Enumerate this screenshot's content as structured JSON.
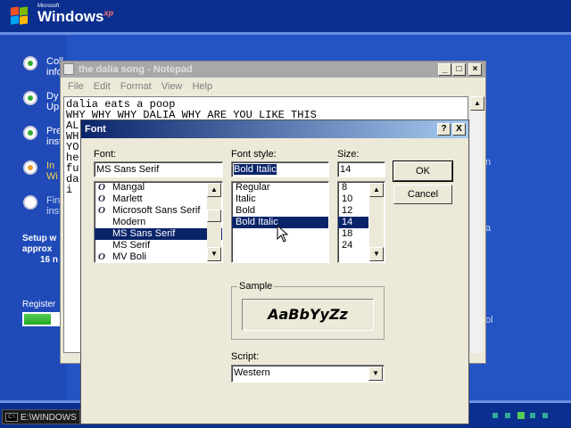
{
  "setup": {
    "logo_small": "Microsoft",
    "logo_main": "Windows",
    "logo_sup": "xp",
    "steps": [
      {
        "line1": "Coll",
        "line2": "info",
        "state": "done"
      },
      {
        "line1": "Dy",
        "line2": "Up",
        "state": "done"
      },
      {
        "line1": "Pre",
        "line2": "inst",
        "state": "done"
      },
      {
        "line1": "In",
        "line2": "Wi",
        "state": "current"
      },
      {
        "line1": "Fin",
        "line2": "inst",
        "state": "future"
      }
    ],
    "time_line1": "Setup w",
    "time_line2": "approx",
    "time_line3": "16 n",
    "register_label": "Register",
    "right_fragments": [
      "n",
      "a",
      "ol"
    ]
  },
  "notepad": {
    "title": "the dalia song - Notepad",
    "menu": [
      "File",
      "Edit",
      "Format",
      "View",
      "Help"
    ],
    "lines": [
      "dalia eats a poop",
      "WHY WHY WHY DALIA WHY ARE YOU LIKE THIS",
      "AL",
      "WH",
      "YO",
      "he",
      "fu",
      "da",
      "i"
    ]
  },
  "font_dialog": {
    "title": "Font",
    "help_btn": "?",
    "close_btn": "X",
    "font_label": "Font:",
    "font_value": "MS Sans Serif",
    "fonts": [
      {
        "name": "Mangal",
        "icon": "O"
      },
      {
        "name": "Marlett",
        "icon": "O"
      },
      {
        "name": "Microsoft Sans Serif",
        "icon": "O"
      },
      {
        "name": "Modern",
        "icon": ""
      },
      {
        "name": "MS Sans Serif",
        "icon": ""
      },
      {
        "name": "MS Serif",
        "icon": ""
      },
      {
        "name": "MV Boli",
        "icon": "O"
      }
    ],
    "selected_font": "MS Sans Serif",
    "style_label": "Font style:",
    "style_value": "Bold Italic",
    "styles": [
      "Regular",
      "Italic",
      "Bold",
      "Bold Italic"
    ],
    "selected_style": "Bold Italic",
    "size_label": "Size:",
    "size_value": "14",
    "sizes": [
      "8",
      "10",
      "12",
      "14",
      "18",
      "24"
    ],
    "selected_size": "14",
    "ok_label": "OK",
    "cancel_label": "Cancel",
    "sample_label": "Sample",
    "sample_text": "AaBbYyZz",
    "script_label": "Script:",
    "script_value": "Western"
  },
  "taskbar": {
    "cmd_icon": "C:\\",
    "cmd_label": "E:\\WINDOWS"
  }
}
